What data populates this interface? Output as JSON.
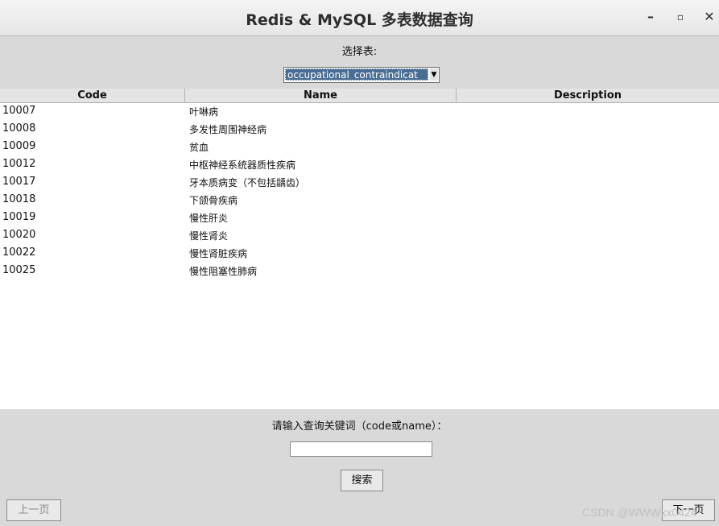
{
  "window": {
    "title": "Redis & MySQL 多表数据查询"
  },
  "window_controls": {
    "minimize": "–",
    "maximize": "▫",
    "close": "✕"
  },
  "table_select": {
    "label": "选择表:",
    "value": "occupational_contraindicat"
  },
  "table": {
    "columns": [
      "Code",
      "Name",
      "Description"
    ],
    "rows": [
      [
        "10007",
        "叶啉病",
        ""
      ],
      [
        "10008",
        "多发性周围神经病",
        ""
      ],
      [
        "10009",
        "贫血",
        ""
      ],
      [
        "10012",
        "中枢神经系统器质性疾病",
        ""
      ],
      [
        "10017",
        "牙本质病变（不包括龋齿）",
        ""
      ],
      [
        "10018",
        "下颌骨疾病",
        ""
      ],
      [
        "10019",
        "慢性肝炎",
        ""
      ],
      [
        "10020",
        "慢性肾炎",
        ""
      ],
      [
        "10022",
        "慢性肾脏疾病",
        ""
      ],
      [
        "10025",
        "慢性阻塞性肺病",
        ""
      ]
    ]
  },
  "search": {
    "label": "请输入查询关键词（code或name）：",
    "value": "",
    "button": "搜索"
  },
  "pagination": {
    "prev": "上一页",
    "next": "下一页"
  },
  "watermark": "CSDN @WWWxx0424"
}
